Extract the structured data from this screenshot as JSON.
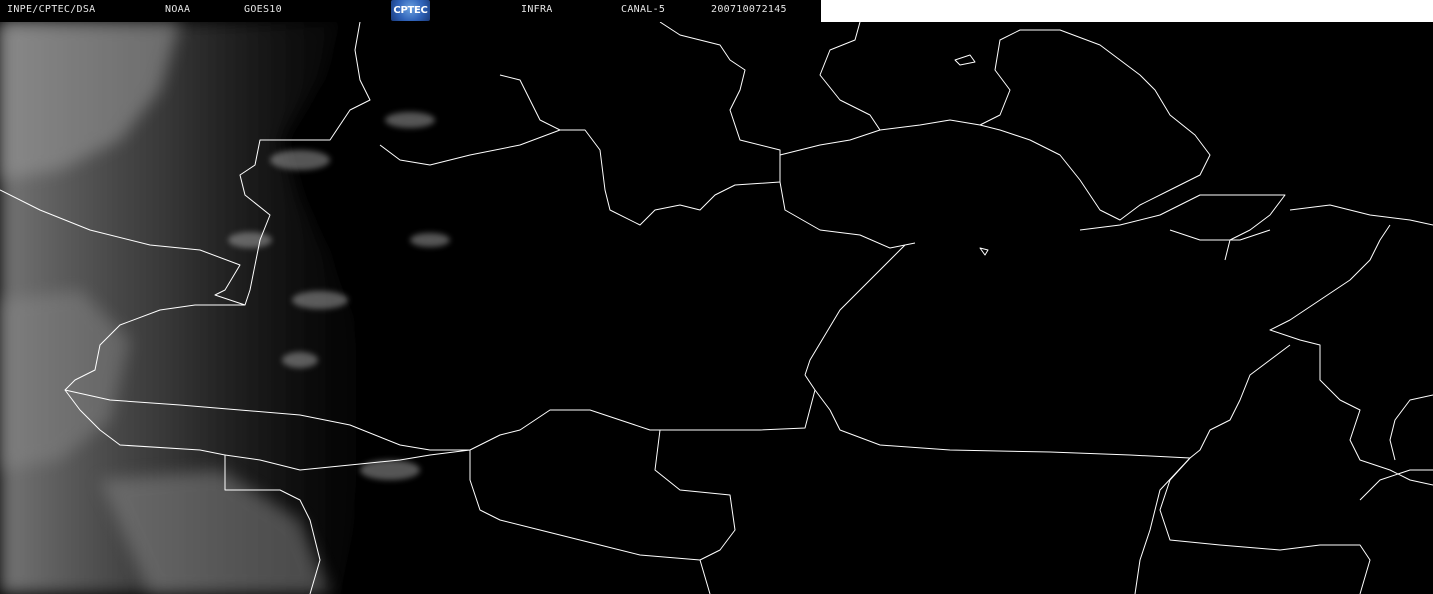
{
  "header": {
    "institution": "INPE/CPTEC/DSA",
    "agency": "NOAA",
    "satellite": "GOES10",
    "logo_text": "CPTEC",
    "band": "INFRA",
    "channel": "CANAL-5",
    "timestamp": "200710072145"
  },
  "colors": {
    "background": "#000000",
    "borders": "#ffffff",
    "cloud": "#bdbdbd",
    "logo": "#2f62b8"
  }
}
